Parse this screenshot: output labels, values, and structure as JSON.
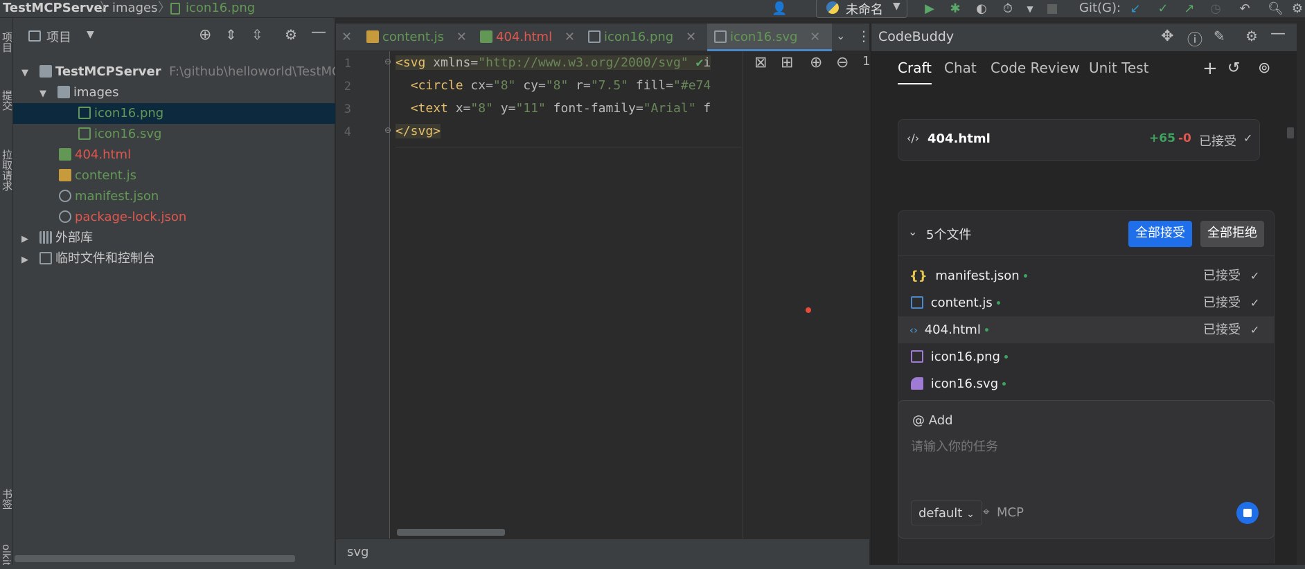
{
  "breadcrumb": [
    "TestMCPServer",
    "images",
    "icon16.png"
  ],
  "toolbar": {
    "run_config": "未命名",
    "git_label": "Git(G):"
  },
  "left_strip": [
    "项目",
    "提交",
    "拉取请求",
    "书签",
    "olkit"
  ],
  "project": {
    "title": "项目",
    "tree": [
      {
        "label": "TestMCPServer",
        "path": "F:\\github\\helloworld\\TestMCP",
        "type": "folder",
        "depth": 0,
        "expanded": true
      },
      {
        "label": "images",
        "type": "folder",
        "depth": 1,
        "expanded": true
      },
      {
        "label": "icon16.png",
        "type": "png",
        "depth": 2,
        "selected": true
      },
      {
        "label": "icon16.svg",
        "type": "svg",
        "depth": 2
      },
      {
        "label": "404.html",
        "type": "html",
        "depth": 1
      },
      {
        "label": "content.js",
        "type": "js",
        "depth": 1
      },
      {
        "label": "manifest.json",
        "type": "json",
        "depth": 1
      },
      {
        "label": "package-lock.json",
        "type": "json",
        "depth": 1
      },
      {
        "label": "外部库",
        "type": "lib",
        "depth": 0,
        "expanded": false
      },
      {
        "label": "临时文件和控制台",
        "type": "scratch",
        "depth": 0,
        "expanded": false
      }
    ]
  },
  "editor": {
    "tabs": [
      {
        "label": "content.js",
        "color": "#629755"
      },
      {
        "label": "404.html",
        "color": "#e0574f"
      },
      {
        "label": "icon16.png",
        "color": "#629755"
      },
      {
        "label": "icon16.svg",
        "color": "#629755",
        "active": true
      }
    ],
    "lines": [
      "1",
      "2",
      "3",
      "4"
    ],
    "status": "svg"
  },
  "codebuddy": {
    "title": "CodeBuddy",
    "tabs": [
      "Craft",
      "Chat",
      "Code Review",
      "Unit Test"
    ],
    "diff_card": {
      "file": "404.html",
      "added": "+65",
      "removed": "-0",
      "status": "已接受"
    },
    "files_card": {
      "count_label": "5个文件",
      "accept_all": "全部接受",
      "reject_all": "全部拒绝",
      "files": [
        {
          "name": "manifest.json",
          "status": "已接受",
          "icon": "json-icon"
        },
        {
          "name": "content.js",
          "status": "已接受",
          "icon": "js-file-icon"
        },
        {
          "name": "404.html",
          "status": "已接受",
          "icon": "html-icon"
        },
        {
          "name": "icon16.png",
          "status": "",
          "icon": "image-icon"
        },
        {
          "name": "icon16.svg",
          "status": "",
          "icon": "svg-icon"
        }
      ]
    },
    "input": {
      "add_label": "@ Add",
      "placeholder": "请输入你的任务",
      "model": "default",
      "mcp": "MCP"
    }
  },
  "colors": {
    "accent": "#1f6feb",
    "green": "#3ea35f",
    "red": "#e0574f"
  }
}
